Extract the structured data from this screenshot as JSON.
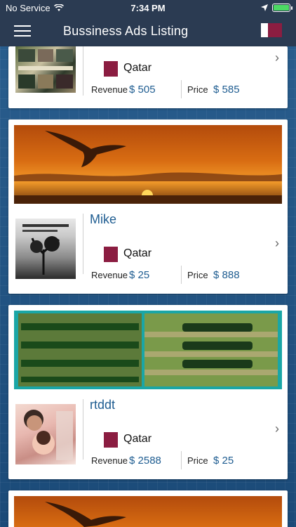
{
  "status": {
    "carrier": "No Service",
    "time": "7:34 PM"
  },
  "nav": {
    "title": "Bussiness Ads Listing"
  },
  "listings": [
    {
      "name": "",
      "country": "Qatar",
      "revenue_label": "Revenue",
      "revenue": "$ 505",
      "price_label": "Price",
      "price": "$ 585"
    },
    {
      "name": "Mike",
      "country": "Qatar",
      "revenue_label": "Revenue",
      "revenue": "$ 25",
      "price_label": "Price",
      "price": "$ 888"
    },
    {
      "name": "rtddt",
      "country": "Qatar",
      "revenue_label": "Revenue",
      "revenue": "$ 2588",
      "price_label": "Price",
      "price": "$ 25"
    }
  ],
  "icons": {
    "menu": "hamburger-icon",
    "flag": "qatar-flag-icon",
    "chevron": "chevron-right-icon",
    "wifi": "wifi-icon",
    "location": "location-arrow-icon",
    "battery": "battery-icon"
  },
  "colors": {
    "nav": "#2b3b52",
    "accent": "#1f5d91",
    "flag": "#8b1d41",
    "background": "#1d4f7e"
  }
}
